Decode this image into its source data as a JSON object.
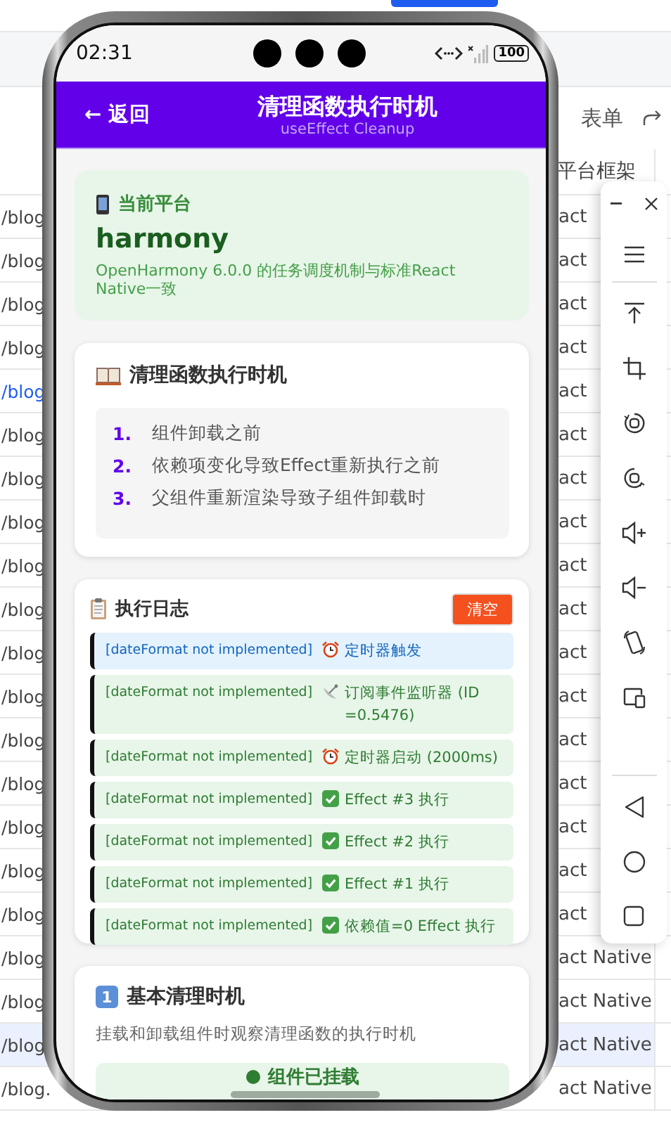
{
  "page": {
    "action_label": "表单",
    "table": {
      "columns": [
        {
          "label": "平台框架"
        }
      ],
      "rows": [
        {
          "column_1": "/blog",
          "column_2": "act",
          "selected": false,
          "linked": false
        },
        {
          "column_1": "/blog",
          "column_2": "act",
          "selected": false,
          "linked": false
        },
        {
          "column_1": "/blog",
          "column_2": "act",
          "selected": false,
          "linked": false
        },
        {
          "column_1": "/blog",
          "column_2": "act",
          "selected": false,
          "linked": false
        },
        {
          "column_1": "/blog",
          "column_2": "act",
          "selected": false,
          "linked": true
        },
        {
          "column_1": "/blog",
          "column_2": "act",
          "selected": false,
          "linked": false
        },
        {
          "column_1": "/blog",
          "column_2": "act",
          "selected": false,
          "linked": false
        },
        {
          "column_1": "/blog",
          "column_2": "act",
          "selected": false,
          "linked": false
        },
        {
          "column_1": "/blog",
          "column_2": "act",
          "selected": false,
          "linked": false
        },
        {
          "column_1": "/blog",
          "column_2": "act",
          "selected": false,
          "linked": false
        },
        {
          "column_1": "/blog",
          "column_2": "act",
          "selected": false,
          "linked": false
        },
        {
          "column_1": "/blog",
          "column_2": "act",
          "selected": false,
          "linked": false
        },
        {
          "column_1": "/blog",
          "column_2": "act",
          "selected": false,
          "linked": false
        },
        {
          "column_1": "/blog",
          "column_2": "act",
          "selected": false,
          "linked": false
        },
        {
          "column_1": "/blog",
          "column_2": "act",
          "selected": false,
          "linked": false
        },
        {
          "column_1": "/blog",
          "column_2": "act",
          "selected": false,
          "linked": false
        },
        {
          "column_1": "/blog",
          "column_2": "act",
          "selected": false,
          "linked": false
        },
        {
          "column_1": "/blog",
          "column_2": "act Native",
          "selected": false,
          "linked": false
        },
        {
          "column_1": "/blog",
          "column_2": "act Native",
          "selected": false,
          "linked": false
        },
        {
          "column_1": "/blog",
          "column_2": "act Native",
          "selected": true,
          "linked": false
        },
        {
          "column_1": "/blog.",
          "column_2": "act Native",
          "selected": false,
          "linked": false
        }
      ]
    }
  },
  "phone": {
    "status_bar": {
      "time": "02:31",
      "battery": "100"
    },
    "header": {
      "back": "← 返回",
      "title": "清理函数执行时机",
      "subtitle": "useEffect Cleanup"
    },
    "platform_card": {
      "label": "当前平台",
      "name": "harmony",
      "description": "OpenHarmony 6.0.0 的任务调度机制与标准React Native一致"
    },
    "timing_card": {
      "title": "清理函数执行时机",
      "items": [
        {
          "number": "1.",
          "text": "组件卸载之前"
        },
        {
          "number": "2.",
          "text": "依赖项变化导致Effect重新执行之前"
        },
        {
          "number": "3.",
          "text": "父组件重新渲染导致子组件卸载时"
        }
      ]
    },
    "log_card": {
      "title": "执行日志",
      "clear_button": "清空",
      "entries": [
        {
          "kind": "timer",
          "highlighted": true,
          "time": "[dateFormat not implemented]",
          "message": "定时器触发"
        },
        {
          "kind": "subscribe",
          "highlighted": false,
          "time": "[dateFormat not implemented]",
          "message": "订阅事件监听器 (ID =0.5476)"
        },
        {
          "kind": "timer",
          "highlighted": false,
          "time": "[dateFormat not implemented]",
          "message": "定时器启动 (2000ms)"
        },
        {
          "kind": "effect",
          "highlighted": false,
          "time": "[dateFormat not implemented]",
          "message": "Effect #3 执行"
        },
        {
          "kind": "effect",
          "highlighted": false,
          "time": "[dateFormat not implemented]",
          "message": "Effect #2 执行"
        },
        {
          "kind": "effect",
          "highlighted": false,
          "time": "[dateFormat not implemented]",
          "message": "Effect #1 执行"
        },
        {
          "kind": "effect",
          "highlighted": false,
          "time": "[dateFormat not implemented]",
          "message": "依赖值=0 Effect 执行"
        }
      ]
    },
    "section_card": {
      "badge": "1",
      "title": "基本清理时机",
      "description": "挂载和卸载组件时观察清理函数的执行时机",
      "status": "组件已挂载",
      "mounted": true
    }
  }
}
